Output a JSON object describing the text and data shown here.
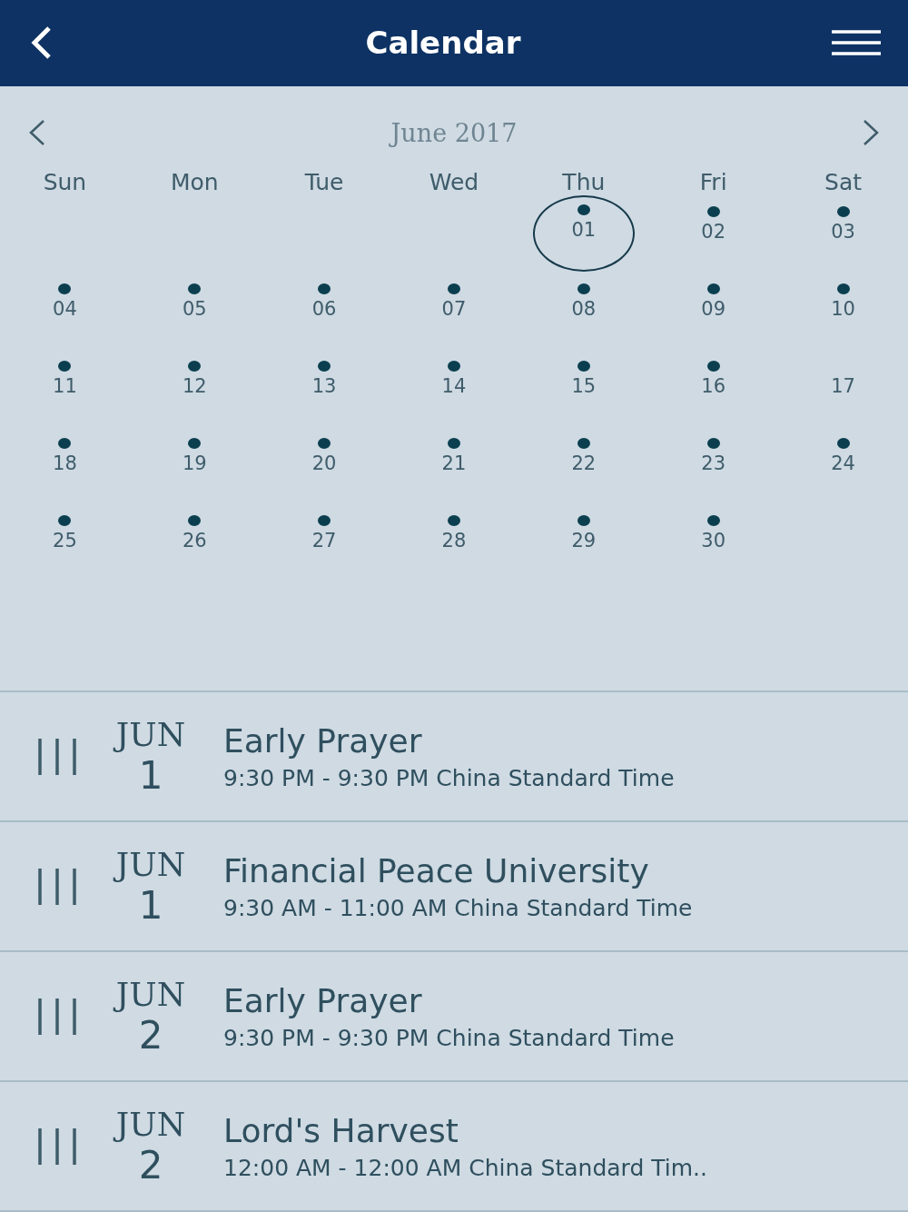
{
  "header": {
    "title": "Calendar"
  },
  "month": {
    "label": "June 2017"
  },
  "weekdays": [
    "Sun",
    "Mon",
    "Tue",
    "Wed",
    "Thu",
    "Fri",
    "Sat"
  ],
  "weeks": [
    [
      {
        "kind": "blank"
      },
      {
        "kind": "blank"
      },
      {
        "kind": "blank"
      },
      {
        "kind": "blank"
      },
      {
        "kind": "day",
        "label": "01",
        "has_event": true,
        "selected": true
      },
      {
        "kind": "day",
        "label": "02",
        "has_event": true,
        "selected": false
      },
      {
        "kind": "day",
        "label": "03",
        "has_event": true,
        "selected": false
      }
    ],
    [
      {
        "kind": "day",
        "label": "04",
        "has_event": true,
        "selected": false
      },
      {
        "kind": "day",
        "label": "05",
        "has_event": true,
        "selected": false
      },
      {
        "kind": "day",
        "label": "06",
        "has_event": true,
        "selected": false
      },
      {
        "kind": "day",
        "label": "07",
        "has_event": true,
        "selected": false
      },
      {
        "kind": "day",
        "label": "08",
        "has_event": true,
        "selected": false
      },
      {
        "kind": "day",
        "label": "09",
        "has_event": true,
        "selected": false
      },
      {
        "kind": "day",
        "label": "10",
        "has_event": true,
        "selected": false
      }
    ],
    [
      {
        "kind": "day",
        "label": "11",
        "has_event": true,
        "selected": false
      },
      {
        "kind": "day",
        "label": "12",
        "has_event": true,
        "selected": false
      },
      {
        "kind": "day",
        "label": "13",
        "has_event": true,
        "selected": false
      },
      {
        "kind": "day",
        "label": "14",
        "has_event": true,
        "selected": false
      },
      {
        "kind": "day",
        "label": "15",
        "has_event": true,
        "selected": false
      },
      {
        "kind": "day",
        "label": "16",
        "has_event": true,
        "selected": false
      },
      {
        "kind": "day",
        "label": "17",
        "has_event": false,
        "selected": false
      }
    ],
    [
      {
        "kind": "day",
        "label": "18",
        "has_event": true,
        "selected": false
      },
      {
        "kind": "day",
        "label": "19",
        "has_event": true,
        "selected": false
      },
      {
        "kind": "day",
        "label": "20",
        "has_event": true,
        "selected": false
      },
      {
        "kind": "day",
        "label": "21",
        "has_event": true,
        "selected": false
      },
      {
        "kind": "day",
        "label": "22",
        "has_event": true,
        "selected": false
      },
      {
        "kind": "day",
        "label": "23",
        "has_event": true,
        "selected": false
      },
      {
        "kind": "day",
        "label": "24",
        "has_event": true,
        "selected": false
      }
    ],
    [
      {
        "kind": "day",
        "label": "25",
        "has_event": true,
        "selected": false
      },
      {
        "kind": "day",
        "label": "26",
        "has_event": true,
        "selected": false
      },
      {
        "kind": "day",
        "label": "27",
        "has_event": true,
        "selected": false
      },
      {
        "kind": "day",
        "label": "28",
        "has_event": true,
        "selected": false
      },
      {
        "kind": "day",
        "label": "29",
        "has_event": true,
        "selected": false
      },
      {
        "kind": "day",
        "label": "30",
        "has_event": true,
        "selected": false
      },
      {
        "kind": "blank"
      }
    ],
    [
      {
        "kind": "blank"
      },
      {
        "kind": "blank"
      },
      {
        "kind": "blank"
      },
      {
        "kind": "blank"
      },
      {
        "kind": "blank"
      },
      {
        "kind": "blank"
      },
      {
        "kind": "blank"
      }
    ]
  ],
  "events": [
    {
      "month": "JUN",
      "day": "1",
      "title": "Early Prayer",
      "time": "9:30 PM - 9:30 PM China Standard Time"
    },
    {
      "month": "JUN",
      "day": "1",
      "title": "Financial Peace University",
      "time": "9:30 AM - 11:00 AM China Standard Time"
    },
    {
      "month": "JUN",
      "day": "2",
      "title": "Early Prayer",
      "time": "9:30 PM - 9:30 PM China Standard Time"
    },
    {
      "month": "JUN",
      "day": "2",
      "title": "Lord's Harvest",
      "time": "12:00 AM - 12:00 AM China Standard Tim.."
    }
  ]
}
